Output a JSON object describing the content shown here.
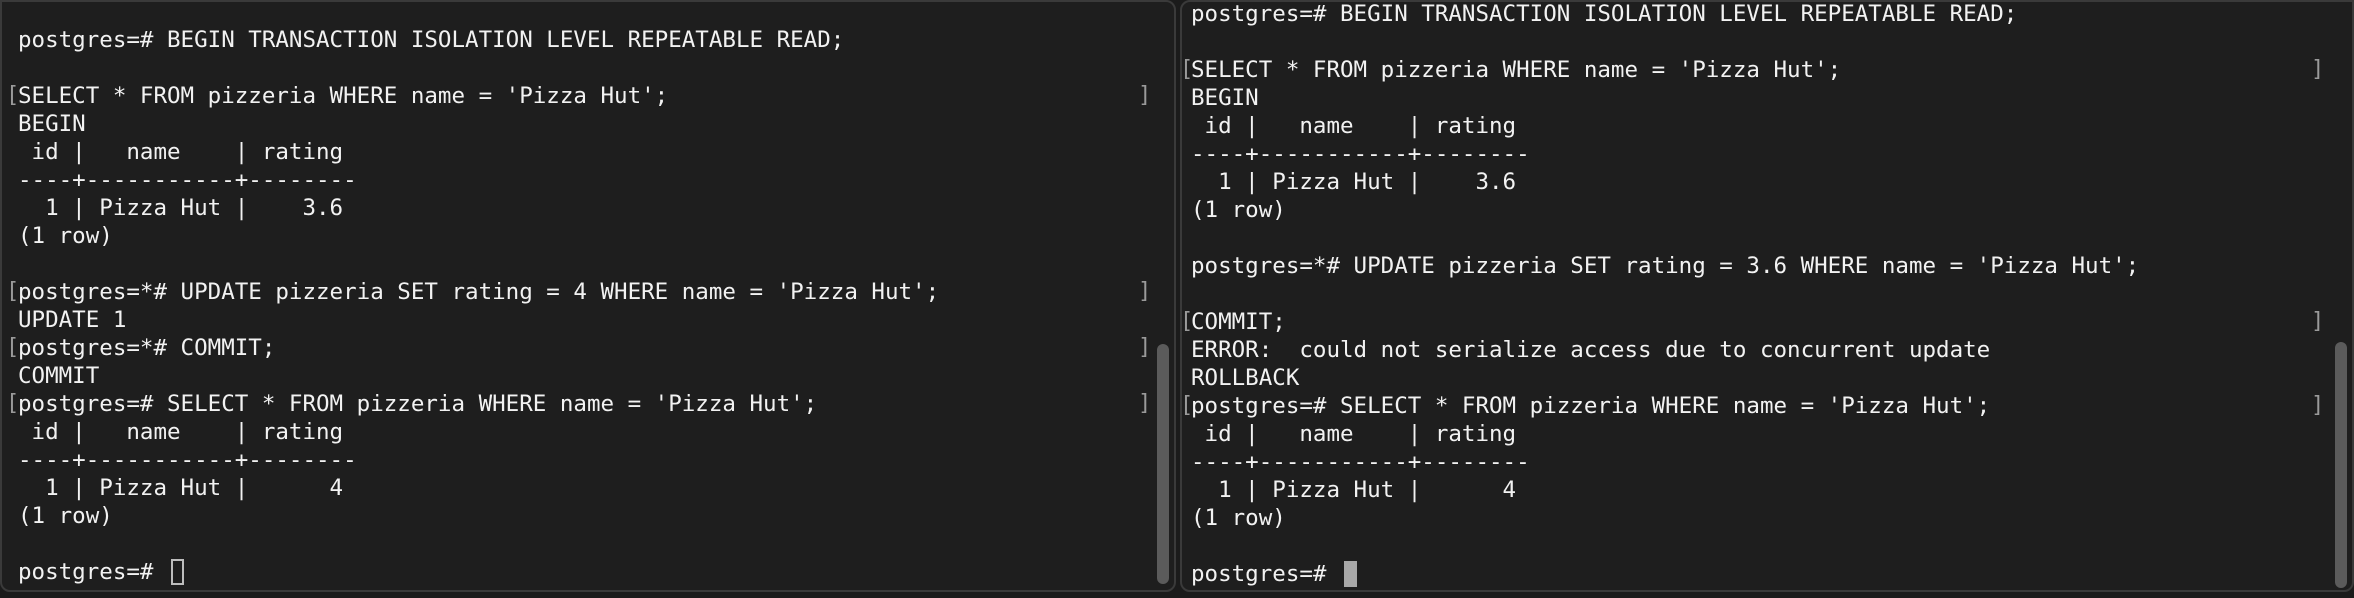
{
  "left_pane": {
    "lines": [
      "postgres=# BEGIN TRANSACTION ISOLATION LEVEL REPEATABLE READ;",
      "",
      "SELECT * FROM pizzeria WHERE name = 'Pizza Hut';",
      "BEGIN",
      " id |   name    | rating",
      "----+-----------+--------",
      "  1 | Pizza Hut |    3.6",
      "(1 row)",
      "",
      "postgres=*# UPDATE pizzeria SET rating = 4 WHERE name = 'Pizza Hut';",
      "UPDATE 1",
      "postgres=*# COMMIT;",
      "COMMIT",
      "postgres=# SELECT * FROM pizzeria WHERE name = 'Pizza Hut';",
      " id |   name    | rating",
      "----+-----------+--------",
      "  1 | Pizza Hut |      4",
      "(1 row)",
      "",
      "postgres=# "
    ]
  },
  "right_pane": {
    "lines": [
      "postgres=# BEGIN TRANSACTION ISOLATION LEVEL REPEATABLE READ;",
      "",
      "SELECT * FROM pizzeria WHERE name = 'Pizza Hut';",
      "BEGIN",
      " id |   name    | rating",
      "----+-----------+--------",
      "  1 | Pizza Hut |    3.6",
      "(1 row)",
      "",
      "postgres=*# UPDATE pizzeria SET rating = 3.6 WHERE name = 'Pizza Hut';",
      "",
      "COMMIT;",
      "ERROR:  could not serialize access due to concurrent update",
      "ROLLBACK",
      "postgres=# SELECT * FROM pizzeria WHERE name = 'Pizza Hut';",
      " id |   name    | rating",
      "----+-----------+--------",
      "  1 | Pizza Hut |      4",
      "(1 row)",
      "",
      "postgres=# "
    ]
  },
  "colors": {
    "background": "#1e1e1e",
    "text": "#f2f2f2",
    "border": "#3a3a3a"
  }
}
